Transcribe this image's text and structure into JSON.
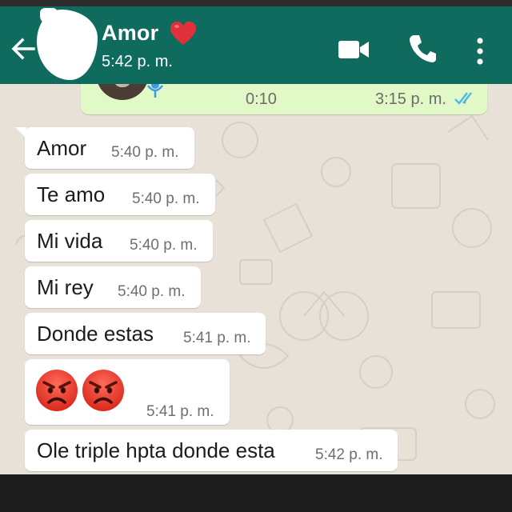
{
  "header": {
    "contact_name": "Amor",
    "last_seen": "5:42 p. m.",
    "color": "#0e6b5e",
    "icons": [
      "back-arrow-icon",
      "red-heart-icon",
      "video-call-icon",
      "phone-call-icon",
      "more-options-icon"
    ]
  },
  "audio_message": {
    "duration": "0:10",
    "time": "3:15 p. m.",
    "status": "read",
    "bubble_color": "#e1f9c7",
    "tick_color": "#4fb6ec"
  },
  "messages": [
    {
      "text": "Amor",
      "time": "5:40 p. m."
    },
    {
      "text": "Te amo",
      "time": "5:40 p. m."
    },
    {
      "text": "Mi vida",
      "time": "5:40 p. m."
    },
    {
      "text": "Mi rey",
      "time": "5:40 p. m."
    },
    {
      "text": "Donde estas",
      "time": "5:41 p. m."
    },
    {
      "text": "",
      "emojis": [
        "angry-face-icon",
        "angry-face-icon"
      ],
      "time": "5:41 p. m."
    },
    {
      "text": "Ole triple hpta donde esta",
      "time": "5:42 p. m."
    }
  ]
}
